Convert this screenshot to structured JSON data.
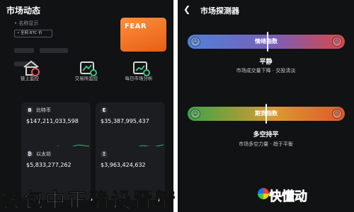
{
  "left": {
    "title": "市场动态",
    "subtitle": "• 名称显示",
    "badge": "• 全网 BTC 价",
    "fear": {
      "label": "FEAR",
      "value": ""
    },
    "functions": [
      {
        "label": "链上监控",
        "icon": "house-chart-icon"
      },
      {
        "label": "交易所监控",
        "icon": "exchange-chart-icon"
      },
      {
        "label": "每日市场分析",
        "icon": "analysis-chart-icon"
      }
    ],
    "coins": [
      {
        "symbol": "B",
        "name": "比特币",
        "price": "$147,211,033,598",
        "change": ""
      },
      {
        "symbol": "E",
        "name": "",
        "price": "$35,387,995,437",
        "change": ""
      },
      {
        "symbol": "₿",
        "name": "以太坊",
        "price": "$5,833,277,262",
        "change": ""
      },
      {
        "symbol": "Ξ",
        "name": "",
        "price": "$3,963,424,632",
        "change": ""
      }
    ]
  },
  "right": {
    "title": "市场探测器",
    "meter_top": {
      "label": "情绪指数",
      "level": 0.51
    },
    "state_top": {
      "title": "平静",
      "desc": "市场成交量下降 · 交投清淡"
    },
    "meter_bottom": {
      "label": "期货指数",
      "level": 0.5
    },
    "state_bottom": {
      "title": "多空持平",
      "desc": "市场多空力量 · 趋于平衡"
    }
  },
  "caption": {
    "text": "钱包中正确设置精",
    "brand": "快懂动"
  },
  "colors": {
    "background": "#111214",
    "fear_card": "#f2772b",
    "gain": "#2fbf71"
  }
}
